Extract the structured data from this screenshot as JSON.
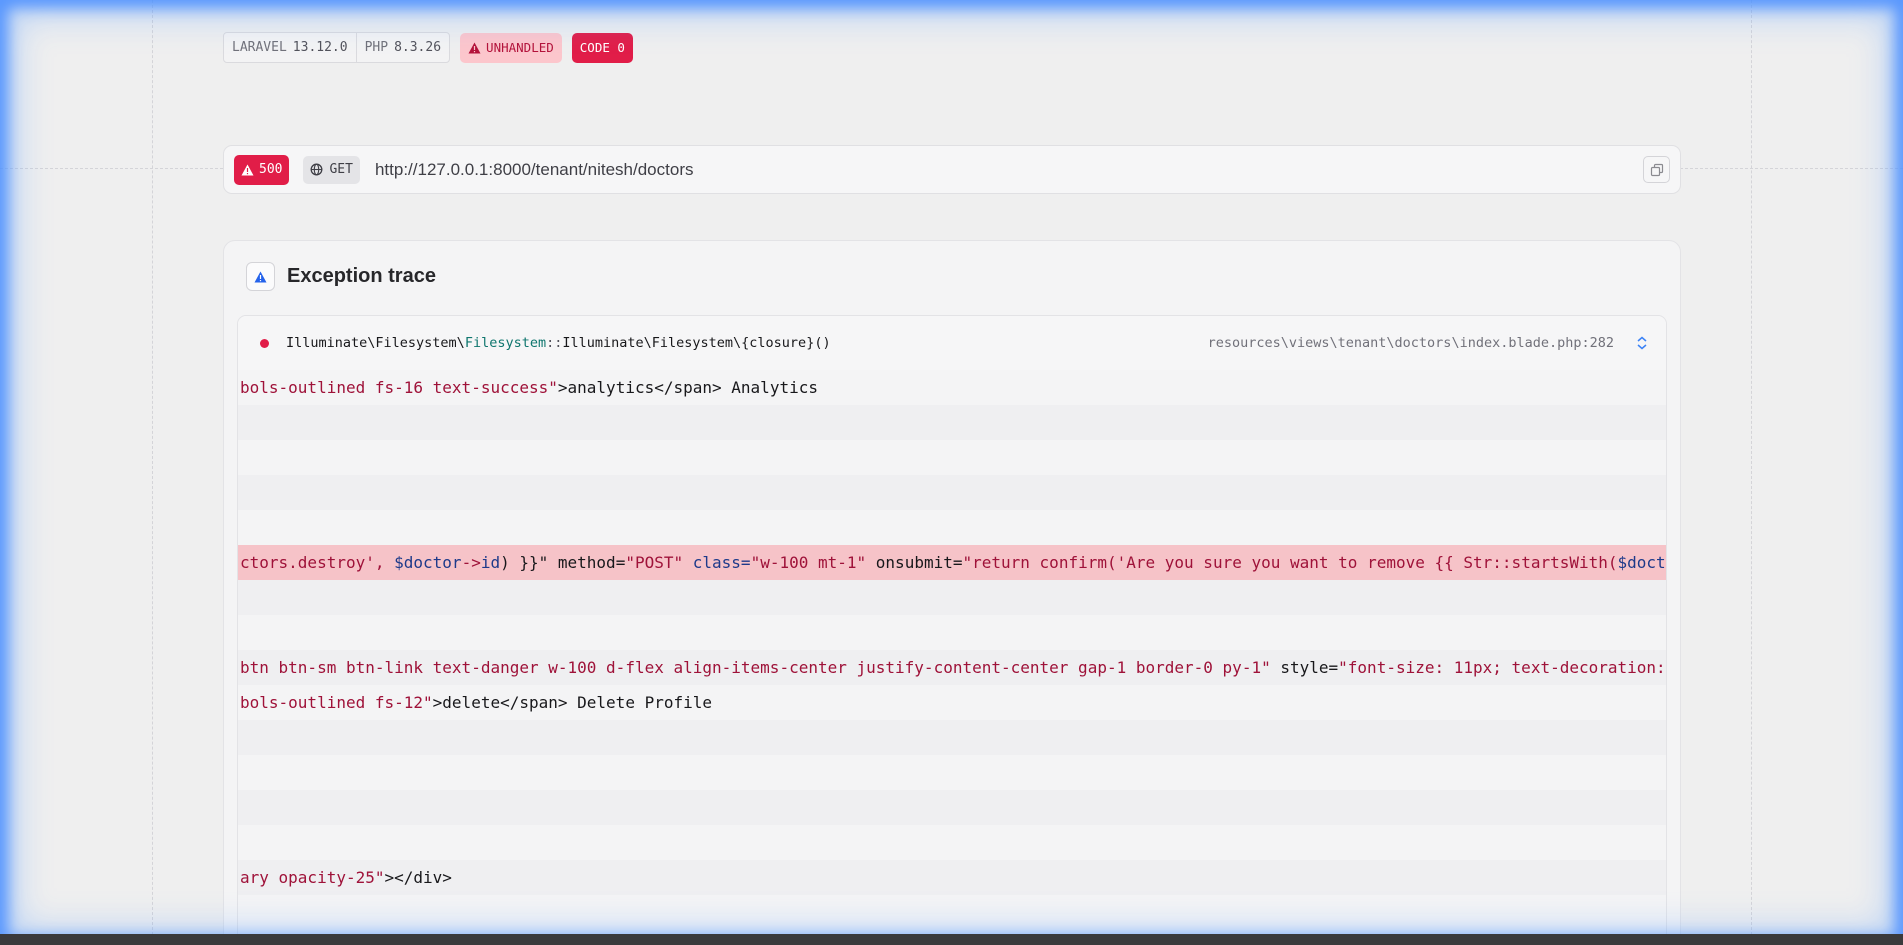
{
  "badges": {
    "laravel_label": "LARAVEL",
    "laravel_version": "13.12.0",
    "php_label": "PHP",
    "php_version": "8.3.26",
    "unhandled": "UNHANDLED",
    "code": "CODE 0"
  },
  "request": {
    "status": "500",
    "method": "GET",
    "url": "http://127.0.0.1:8000/tenant/nitesh/doctors"
  },
  "trace": {
    "title": "Exception trace",
    "frame": {
      "fn_prefix": "Illuminate\\Filesystem\\",
      "fn_class": "Filesystem",
      "fn_sep": "::",
      "fn_rest": "Illuminate\\Filesystem\\{closure}()",
      "file": "resources\\views\\tenant\\doctors\\index.blade.php:282"
    },
    "code_lines": {
      "l1a": "bols-outlined fs-16 text-success\"",
      "l1b": ">analytics</span> Analytics",
      "l6a": "ctors.destroy', ",
      "l6b": "$doctor",
      "l6c": "->",
      "l6d": "id",
      "l6e": ") }}\" method=",
      "l6f": "\"POST\"",
      "l6g": " class=",
      "l6h": "\"w-100 mt-1\"",
      "l6i": " onsubmit=",
      "l6j": "\"return confirm('Are you sure you want to remove {{ Str::startsWith(",
      "l6k": "$docto",
      "l9a": "btn btn-sm btn-link text-danger w-100 d-flex align-items-center justify-content-center gap-1 border-0 py-1\"",
      "l9b": " style=",
      "l9c": "\"font-size: 11px; text-decoration:",
      "l10a": "bols-outlined fs-12\"",
      "l10b": ">delete</span> Delete Profile",
      "l15a": "ary opacity-25\"",
      "l15b": "></div>"
    }
  }
}
